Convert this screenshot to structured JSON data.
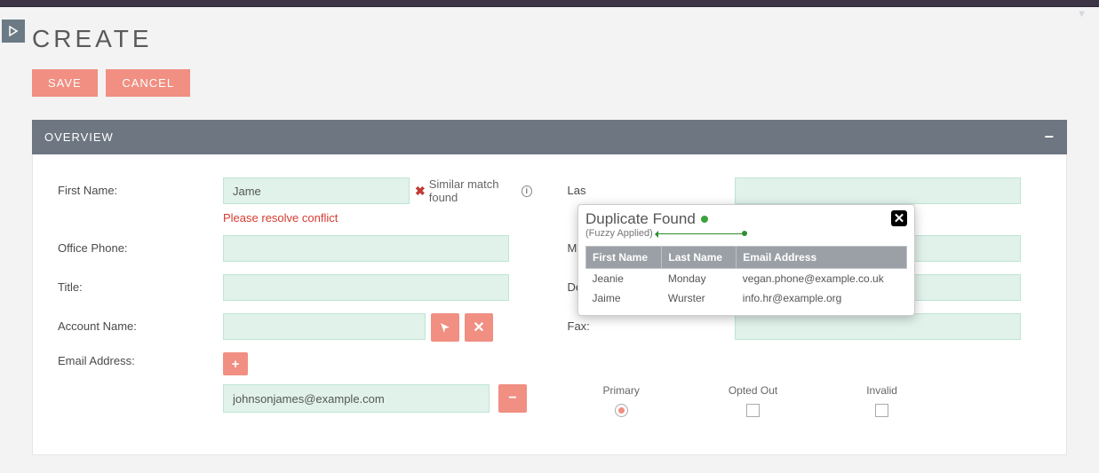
{
  "page": {
    "title": "CREATE",
    "section_header": "OVERVIEW"
  },
  "actions": {
    "save": "SAVE",
    "cancel": "CANCEL"
  },
  "labels": {
    "first_name": "First Name:",
    "last_name": "Las",
    "office_phone": "Office Phone:",
    "mobile": "Mo",
    "title": "Title:",
    "department": "Department:",
    "account_name": "Account Name:",
    "fax": "Fax:",
    "email_address": "Email Address:"
  },
  "values": {
    "first_name": "Jame",
    "last_name": "",
    "office_phone": "",
    "mobile": "",
    "title": "",
    "department": "",
    "account_name": "",
    "fax": "",
    "email": "johnsonjames@example.com"
  },
  "messages": {
    "similar_match": "Similar match found",
    "resolve_conflict": "Please resolve conflict"
  },
  "email_flags": {
    "primary": "Primary",
    "opted_out": "Opted Out",
    "invalid": "Invalid"
  },
  "popup": {
    "title": "Duplicate Found",
    "subtitle": "(Fuzzy Applied)",
    "columns": {
      "first_name": "First Name",
      "last_name": "Last Name",
      "email": "Email Address"
    },
    "rows": [
      {
        "first_name": "Jeanie",
        "last_name": "Monday",
        "email": "vegan.phone@example.co.uk"
      },
      {
        "first_name": "Jaime",
        "last_name": "Wurster",
        "email": "info.hr@example.org"
      }
    ]
  }
}
